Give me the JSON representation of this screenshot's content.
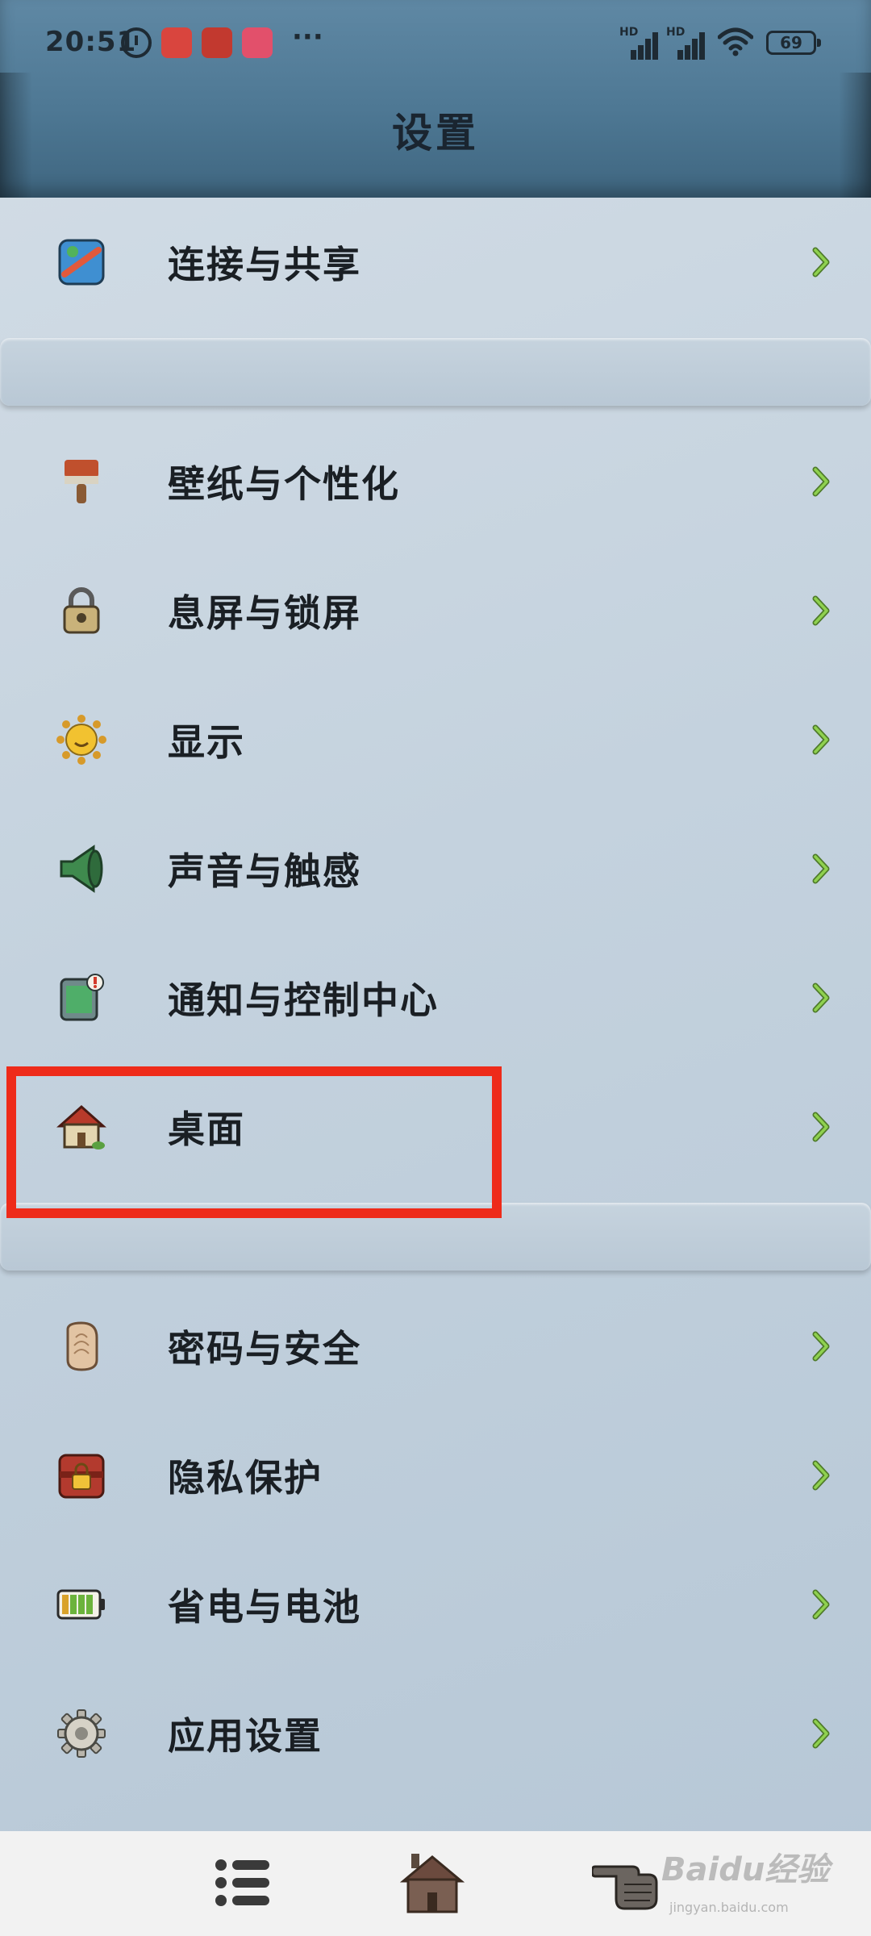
{
  "status_bar": {
    "time": "20:51",
    "battery": "69",
    "more": "···",
    "signal_hd_1": "HD",
    "signal_hd_2": "HD"
  },
  "header": {
    "title": "设置"
  },
  "settings": {
    "group1": [
      {
        "label": "连接与共享",
        "icon": "connection-icon"
      }
    ],
    "group2": [
      {
        "label": "壁纸与个性化",
        "icon": "paintbrush-icon"
      },
      {
        "label": "息屏与锁屏",
        "icon": "padlock-icon"
      },
      {
        "label": "显示",
        "icon": "sun-icon"
      },
      {
        "label": "声音与触感",
        "icon": "speaker-icon"
      },
      {
        "label": "通知与控制中心",
        "icon": "notification-icon"
      },
      {
        "label": "桌面",
        "icon": "house-icon"
      }
    ],
    "group3": [
      {
        "label": "密码与安全",
        "icon": "fingerprint-icon"
      },
      {
        "label": "隐私保护",
        "icon": "privacy-lock-icon"
      },
      {
        "label": "省电与电池",
        "icon": "battery-icon"
      },
      {
        "label": "应用设置",
        "icon": "gear-icon"
      }
    ]
  },
  "bottom_nav": {
    "items": [
      "menu-icon",
      "house-icon",
      "pointing-hand-icon"
    ]
  },
  "watermark": {
    "text": "Baidu经验",
    "sub": "jingyan.baidu.com"
  },
  "colors": {
    "highlight": "#ee2b1a",
    "chevron": "#7cc242"
  }
}
